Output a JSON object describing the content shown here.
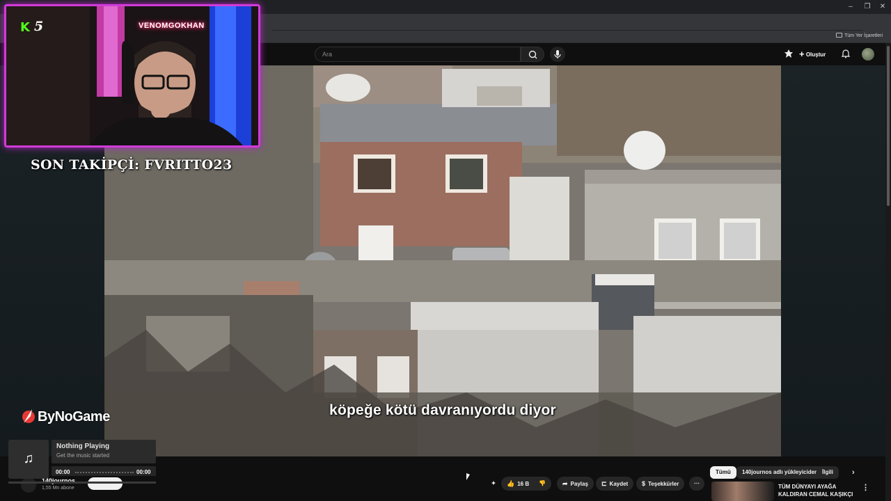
{
  "stream_overlay": {
    "kick_logo": "K",
    "kick_number": "5",
    "neon_sign": "VENOMGOKHAN",
    "last_follower": "SON TAKİPÇİ: FVRITTO23",
    "sponsor": "ByNoGame"
  },
  "music_widget": {
    "title": "Nothing Playing",
    "subtitle": "Get the music started",
    "time_left": "00:00",
    "time_right": "00:00",
    "icon": "music-note-icon"
  },
  "browser": {
    "bookmarks_label": "Tüm Yer İşaretleri"
  },
  "youtube": {
    "search": {
      "placeholder": "Ara"
    },
    "create_label": "Oluştur",
    "video": {
      "subtitle": "köpeğe kötü davranıyordu diyor"
    },
    "channel": {
      "name": "140journos",
      "subscribers": "1,55 Mn abone"
    },
    "actions": {
      "likes": "16 B",
      "share": "Paylaş",
      "save": "Kaydet",
      "thanks": "Teşekkürler"
    },
    "chips": [
      "Tümü",
      "140journos adlı yükleyiciden",
      "İlgili"
    ],
    "recommended": {
      "title": "TÜM DÜNYAYI AYAĞA KALDIRAN CEMAL KAŞIKÇI ..."
    }
  }
}
